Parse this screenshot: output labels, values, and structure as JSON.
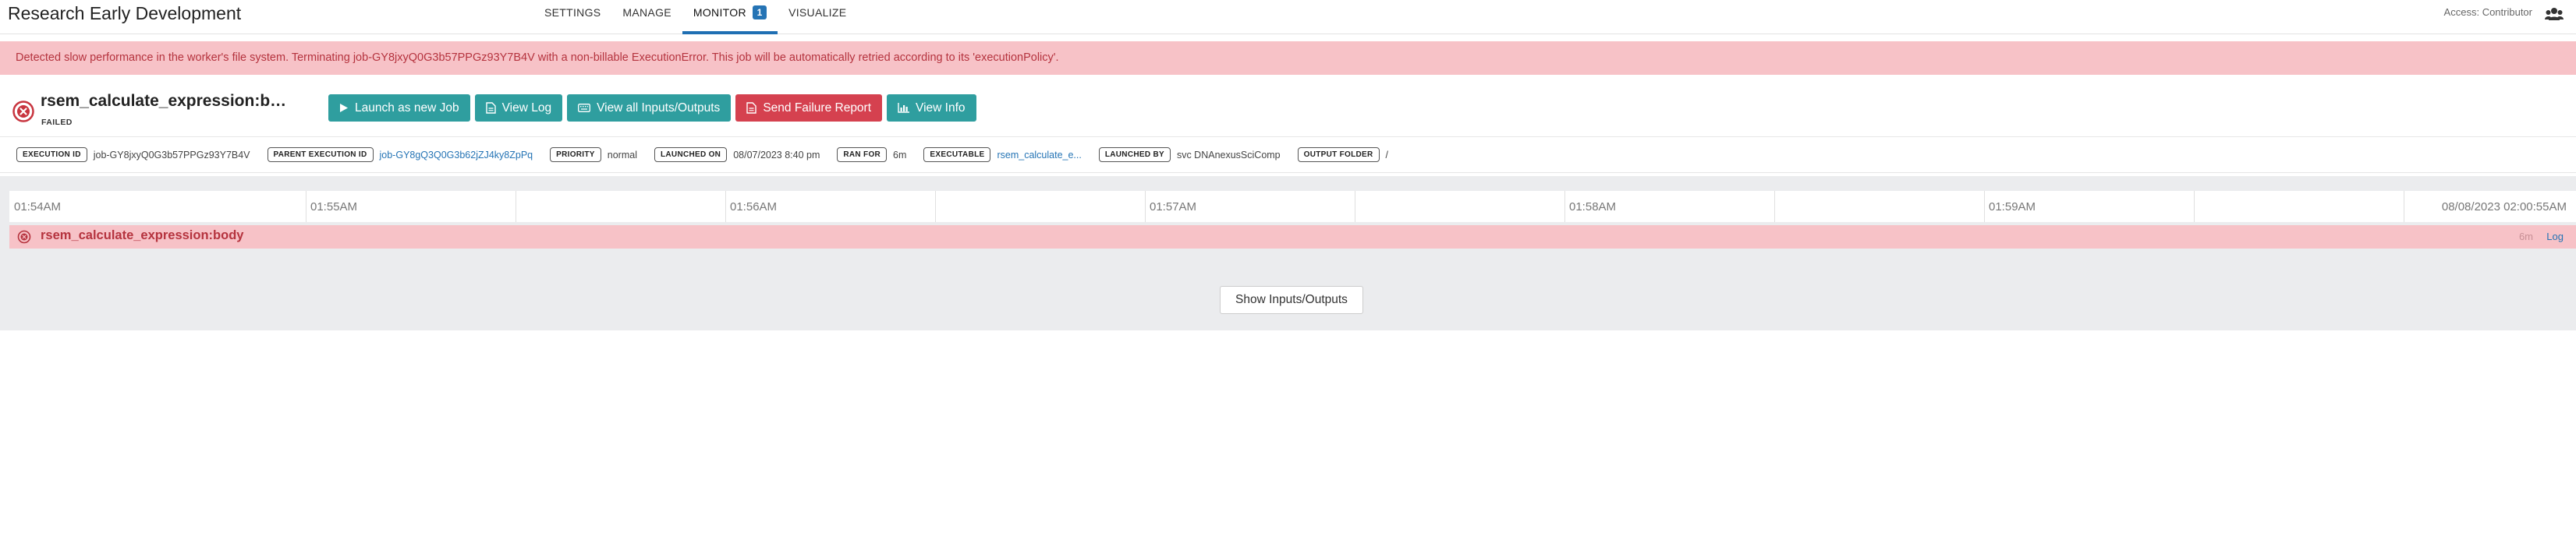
{
  "header": {
    "project_title": "Research Early Development",
    "tabs": [
      {
        "label": "SETTINGS"
      },
      {
        "label": "MANAGE"
      },
      {
        "label": "MONITOR",
        "badge": "1",
        "active": true
      },
      {
        "label": "VISUALIZE"
      }
    ],
    "access_label": "Access:",
    "access_role": "Contributor",
    "user_icon": "users-icon"
  },
  "alert": {
    "message": "Detected slow performance in the worker's file system. Terminating job-GY8jxyQ0G3b57PPGz93Y7B4V with a non-billable ExecutionError. This job will be automatically retried according to its 'executionPolicy'."
  },
  "job": {
    "name": "rsem_calculate_expression:b…",
    "state": "FAILED",
    "status_icon": "failed-icon"
  },
  "actions": {
    "launch": "Launch as new Job",
    "view_log": "View Log",
    "view_io": "View all Inputs/Outputs",
    "send_report": "Send Failure Report",
    "view_info": "View Info"
  },
  "meta": {
    "execution_id": {
      "label": "EXECUTION ID",
      "value": "job-GY8jxyQ0G3b57PPGz93Y7B4V"
    },
    "parent_execution_id": {
      "label": "PARENT EXECUTION ID",
      "value": "job-GY8gQ3Q0G3b62jZJ4ky8ZpPq"
    },
    "priority": {
      "label": "PRIORITY",
      "value": "normal"
    },
    "launched_on": {
      "label": "LAUNCHED ON",
      "value": "08/07/2023 8:40 pm"
    },
    "ran_for": {
      "label": "RAN FOR",
      "value": "6m"
    },
    "executable": {
      "label": "EXECUTABLE",
      "value": "rsem_calculate_e..."
    },
    "launched_by": {
      "label": "LAUNCHED BY",
      "value": "svc DNAnexusSciComp"
    },
    "output_folder": {
      "label": "OUTPUT FOLDER",
      "value": "/"
    }
  },
  "timeline": {
    "ticks": [
      "01:54AM",
      "01:55AM",
      "01:56AM",
      "01:57AM",
      "01:58AM",
      "01:59AM",
      "08/08/2023 02:00:55AM"
    ],
    "row": {
      "name": "rsem_calculate_expression:body",
      "duration": "6m",
      "log_link": "Log"
    },
    "show_io": "Show Inputs/Outputs"
  },
  "colors": {
    "alert_bg": "#f7c2c7",
    "alert_text": "#b5333e",
    "teal": "#2f9e9f",
    "red": "#d5414f",
    "link": "#2574b5"
  }
}
